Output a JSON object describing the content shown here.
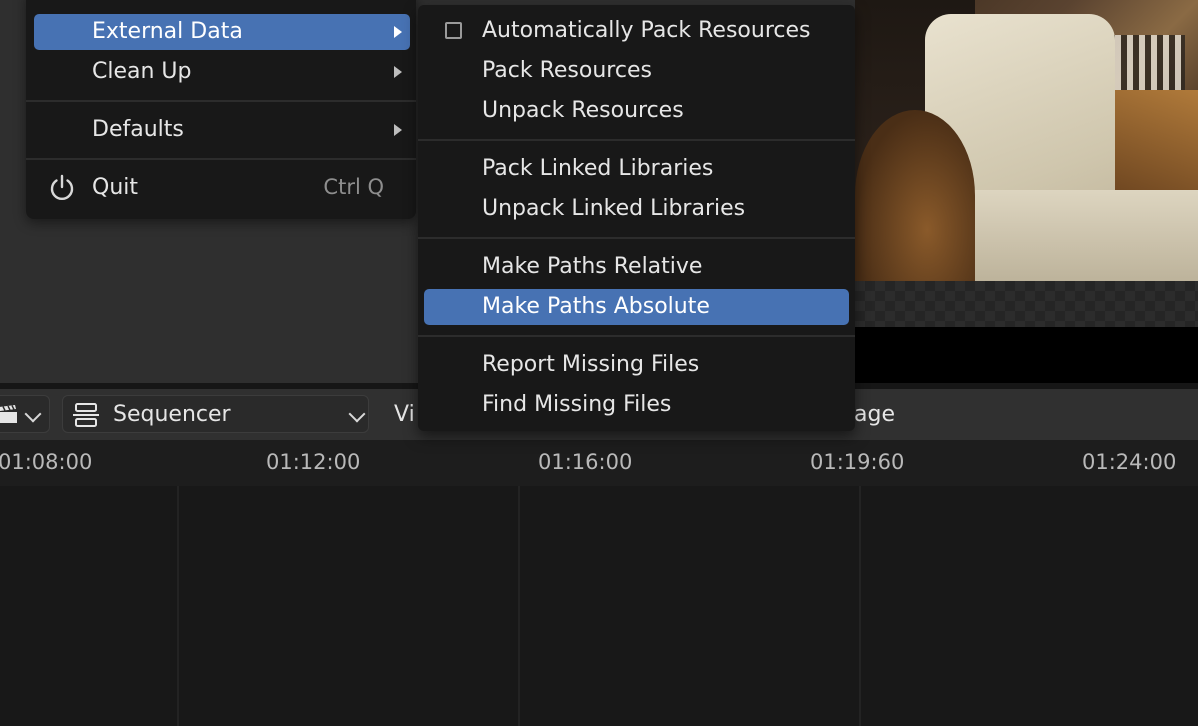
{
  "file_menu": {
    "items": [
      {
        "label": "External Data",
        "has_submenu": true,
        "active": true
      },
      {
        "label": "Clean Up",
        "has_submenu": true
      },
      {
        "label": "Defaults",
        "has_submenu": true
      },
      {
        "label": "Quit",
        "shortcut": "Ctrl Q",
        "icon": "power-icon"
      }
    ]
  },
  "external_data_menu": {
    "auto_pack": {
      "label": "Automatically Pack Resources",
      "checked": false
    },
    "pack_resources": "Pack Resources",
    "unpack_resources": "Unpack Resources",
    "pack_linked_libraries": "Pack Linked Libraries",
    "unpack_linked_libraries": "Unpack Linked Libraries",
    "make_paths_relative": "Make Paths Relative",
    "make_paths_absolute": "Make Paths Absolute",
    "report_missing_files": "Report Missing Files",
    "find_missing_files": "Find Missing Files",
    "highlighted_item": "Make Paths Absolute"
  },
  "sequencer_header": {
    "editor_type_icon": "clapperboard-icon",
    "view_type": {
      "label": "Sequencer",
      "icon": "sequencer-icon"
    },
    "menu_view_partial": "Vi",
    "menu_image_partial": "age"
  },
  "timeline": {
    "ticks": [
      "01:08:00",
      "01:12:00",
      "01:16:00",
      "01:19:60",
      "01:24:00"
    ]
  },
  "colors": {
    "accent": "#4772b3",
    "menu_bg": "#181818",
    "panel_bg": "#303030"
  }
}
